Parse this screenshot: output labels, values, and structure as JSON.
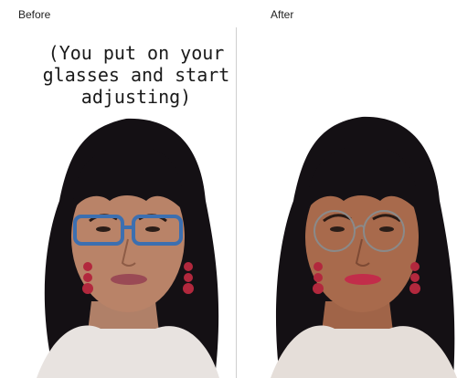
{
  "labels": {
    "before": "Before",
    "after": "After"
  },
  "caption": "(You put on your\nglasses and start\nadjusting)",
  "colors": {
    "hair": "#141014",
    "skin_before": "#b98368",
    "skin_after": "#a86a4c",
    "lips_before": "#9a4a55",
    "lips_after": "#c22d4a",
    "glasses_before": "#3c6fb0",
    "glasses_after": "#8a8a8a",
    "earrings": "#b2283d"
  },
  "icons": {
    "before_glasses": "rectangular-glasses-icon",
    "after_glasses": "round-glasses-icon"
  }
}
